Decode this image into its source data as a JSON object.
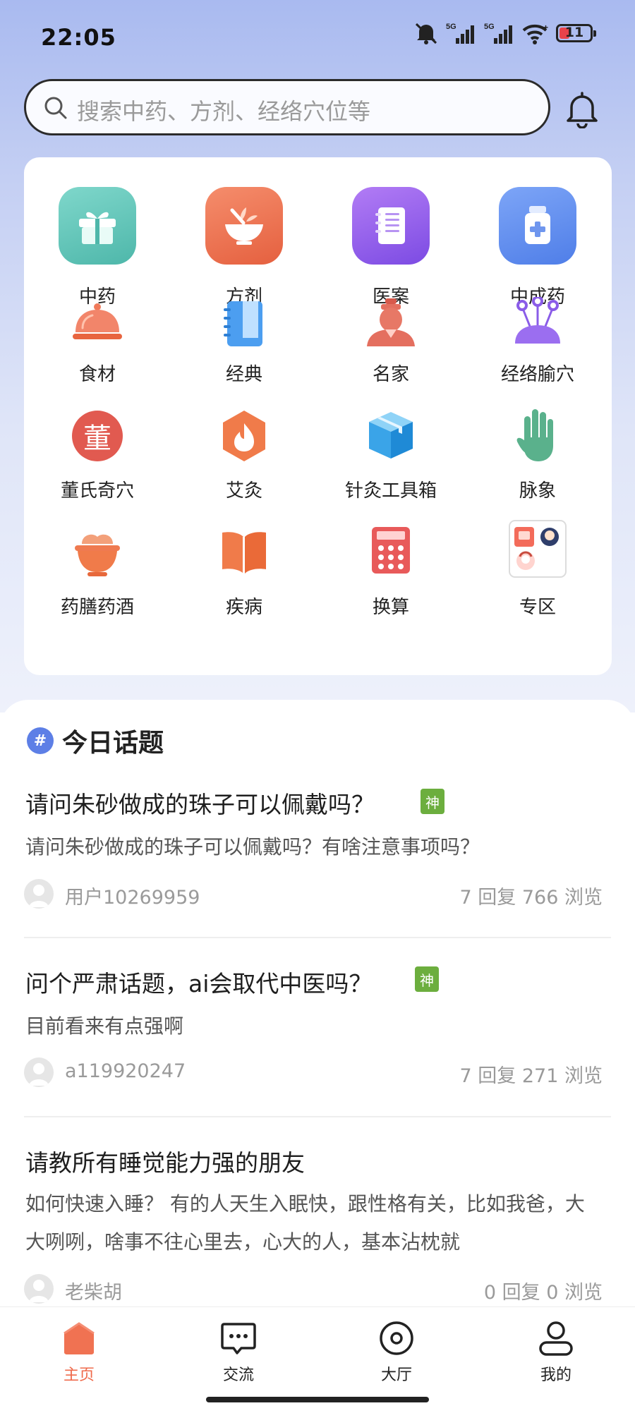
{
  "status_bar": {
    "time": "22:05",
    "battery": "11"
  },
  "search": {
    "placeholder": "搜索中药、方剂、经络穴位等"
  },
  "categories": [
    {
      "label": "中药",
      "icon": "gift-box-icon"
    },
    {
      "label": "方剂",
      "icon": "mortar-bowl-icon"
    },
    {
      "label": "医案",
      "icon": "notebook-icon"
    },
    {
      "label": "中成药",
      "icon": "medicine-bottle-icon"
    },
    {
      "label": "食材",
      "icon": "food-cloche-icon"
    },
    {
      "label": "经典",
      "icon": "classic-book-icon"
    },
    {
      "label": "名家",
      "icon": "master-portrait-icon"
    },
    {
      "label": "经络腧穴",
      "icon": "acupoint-pins-icon"
    },
    {
      "label": "董氏奇穴",
      "icon": "dong-seal-icon"
    },
    {
      "label": "艾灸",
      "icon": "moxa-flame-icon"
    },
    {
      "label": "针灸工具箱",
      "icon": "toolbox-cube-icon"
    },
    {
      "label": "脉象",
      "icon": "hand-pulse-icon"
    },
    {
      "label": "药膳药酒",
      "icon": "medicated-bowl-icon"
    },
    {
      "label": "疾病",
      "icon": "open-book-icon"
    },
    {
      "label": "换算",
      "icon": "calculator-icon"
    },
    {
      "label": "专区",
      "icon": "avatar-collage-icon"
    }
  ],
  "dong_seal_char": "董",
  "topics": {
    "section_title": "今日话题",
    "hash_symbol": "#",
    "tag_label": "神",
    "posts": [
      {
        "title": "请问朱砂做成的珠子可以佩戴吗？",
        "body": "请问朱砂做成的珠子可以佩戴吗？有啥注意事项吗？",
        "user": "用户10269959",
        "stats": "7 回复   766 浏览",
        "tag": true
      },
      {
        "title": "问个严肃话题，ai会取代中医吗？",
        "body": "目前看来有点强啊",
        "user": "a119920247",
        "stats": "7 回复   271 浏览",
        "tag": true
      },
      {
        "title": "请教所有睡觉能力强的朋友",
        "body": "如何快速入睡？ 有的人天生入眠快，跟性格有关，比如我爸，大大咧咧，啥事不往心里去，心大的人，基本沾枕就",
        "user": "老柴胡",
        "stats": "0 回复   0 浏览",
        "tag": false
      }
    ]
  },
  "tabs": [
    {
      "label": "主页",
      "icon": "home-icon",
      "active": true
    },
    {
      "label": "交流",
      "icon": "chat-bubble-icon",
      "active": false
    },
    {
      "label": "大厅",
      "icon": "hall-circle-icon",
      "active": false
    },
    {
      "label": "我的",
      "icon": "user-icon",
      "active": false
    }
  ],
  "colors": {
    "accent": "#ef6a4b",
    "tag_green": "#6cae3e",
    "hash_blue": "#5d7fe6"
  }
}
